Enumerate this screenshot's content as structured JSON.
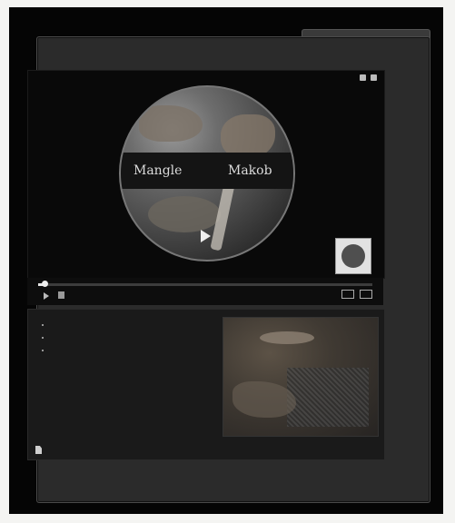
{
  "window": {
    "title": "",
    "page_title": ""
  },
  "player": {
    "top_label": "",
    "banner_left": "Mangle",
    "banner_right": "Makob",
    "thumb_caption": "",
    "progress": 0.02,
    "time": ""
  },
  "panel": {
    "bullets": [
      "",
      "",
      ""
    ],
    "link_text": ""
  },
  "colors": {
    "background": "#050505",
    "window": "#2b2b2b",
    "text": "#bdbdbd"
  },
  "icons": {
    "play": "play-icon",
    "volume": "volume-icon",
    "fullscreen": "fullscreen-icon",
    "file": "file-icon"
  }
}
